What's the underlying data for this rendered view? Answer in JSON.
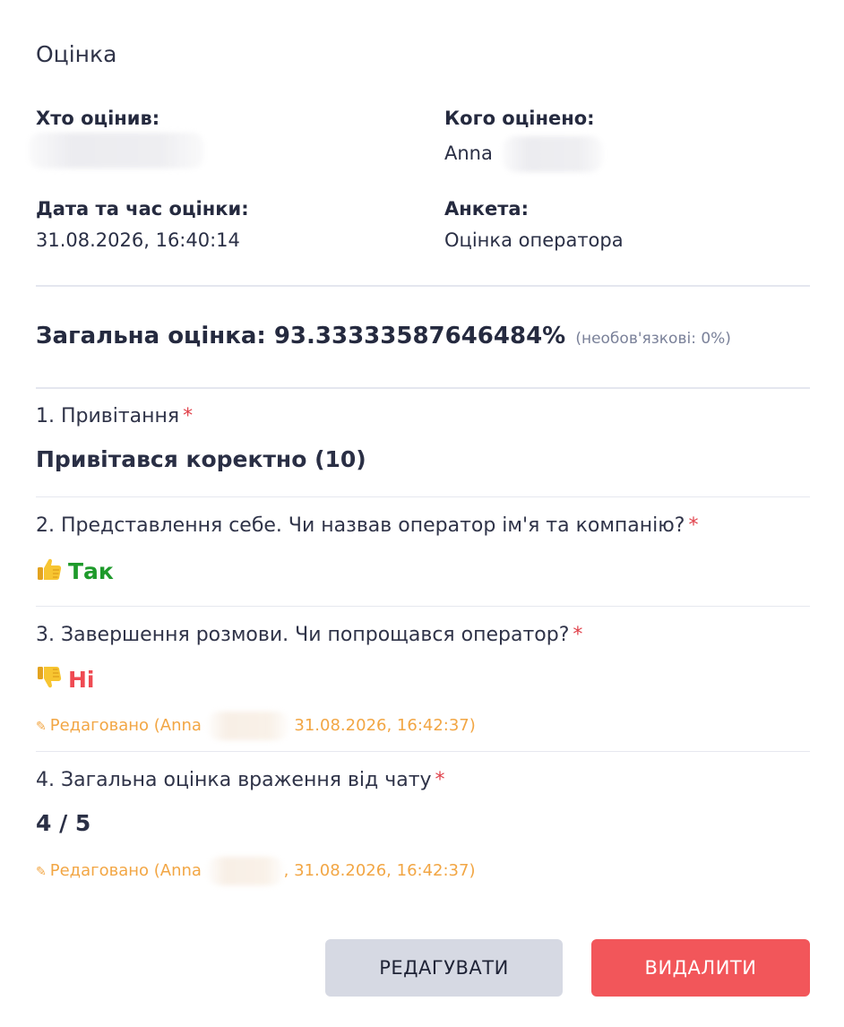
{
  "header": {
    "title": "Оцінка"
  },
  "meta": {
    "evaluator_label": "Хто оцінив:",
    "evaluated_label": "Кого оцінено:",
    "evaluated_name": "Anna",
    "datetime_label": "Дата та час оцінки:",
    "datetime_value": "31.08.2026, 16:40:14",
    "form_label": "Анкета:",
    "form_value": "Оцінка оператора"
  },
  "score": {
    "main": "Загальна оцінка: 93.33333587646484%",
    "note": "(необов'язкові: 0%)"
  },
  "questions": [
    {
      "label": "1. Привітання",
      "required": "*",
      "answer": "Привітався коректно (10)"
    },
    {
      "label": "2. Представлення себе. Чи назвав оператор ім'я та компанію?",
      "required": "*",
      "answer": "Так",
      "icon": "thumbs-up-icon"
    },
    {
      "label": "3. Завершення розмови. Чи попрощався оператор?",
      "required": "*",
      "answer": "Ні",
      "icon": "thumbs-down-icon",
      "edited_prefix": "Редаговано (Anna",
      "edited_suffix": "31.08.2026, 16:42:37)"
    },
    {
      "label": "4. Загальна оцінка враження від чату",
      "required": "*",
      "answer": "4 / 5",
      "edited_prefix": "Редаговано (Anna",
      "edited_suffix": ", 31.08.2026, 16:42:37)"
    }
  ],
  "actions": {
    "edit_label": "РЕДАГУВАТИ",
    "delete_label": "ВИДАЛИТИ"
  },
  "colors": {
    "accent_red": "#f2565a",
    "yes_green": "#1e9a2b",
    "no_red": "#ef4a52",
    "edited_orange": "#f2a644",
    "button_gray": "#d6d9e3"
  }
}
